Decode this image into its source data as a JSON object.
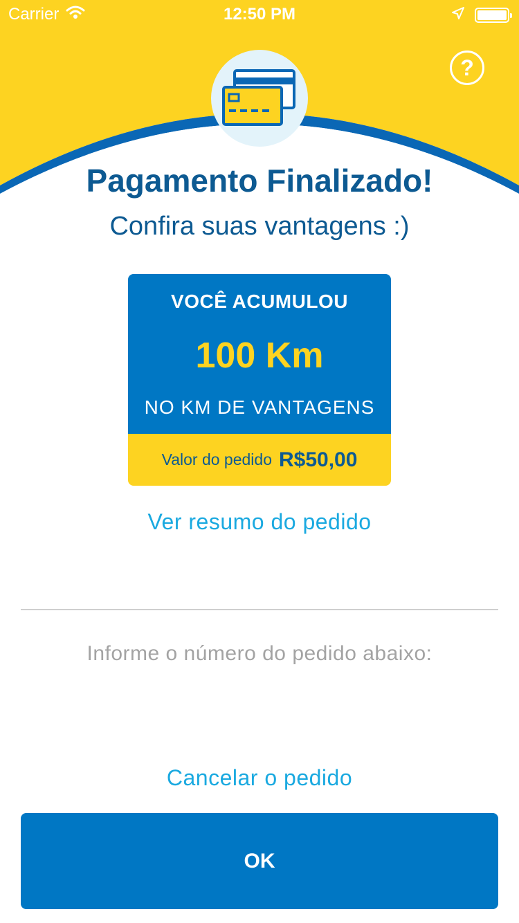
{
  "status_bar": {
    "carrier": "Carrier",
    "time": "12:50 PM"
  },
  "header": {
    "help_label": "?",
    "bg_color": "#fdd321",
    "arc_color": "#0077c4"
  },
  "icons": {
    "card": "credit-card-icon",
    "help": "help-icon",
    "wifi": "wifi-icon",
    "location": "location-arrow-icon",
    "battery": "battery-icon"
  },
  "main": {
    "title": "Pagamento Finalizado!",
    "subtitle": "Confira suas vantagens :)"
  },
  "reward": {
    "heading": "VOCÊ ACUMULOU",
    "amount": "100 Km",
    "program": "NO KM DE VANTAGENS",
    "order_value_label": "Valor do pedido",
    "order_value": "R$50,00"
  },
  "links": {
    "summary": "Ver resumo do pedido",
    "cancel": "Cancelar o pedido"
  },
  "order_input": {
    "value": "",
    "hint": "Informe o número do pedido abaixo:"
  },
  "buttons": {
    "ok": "OK"
  }
}
